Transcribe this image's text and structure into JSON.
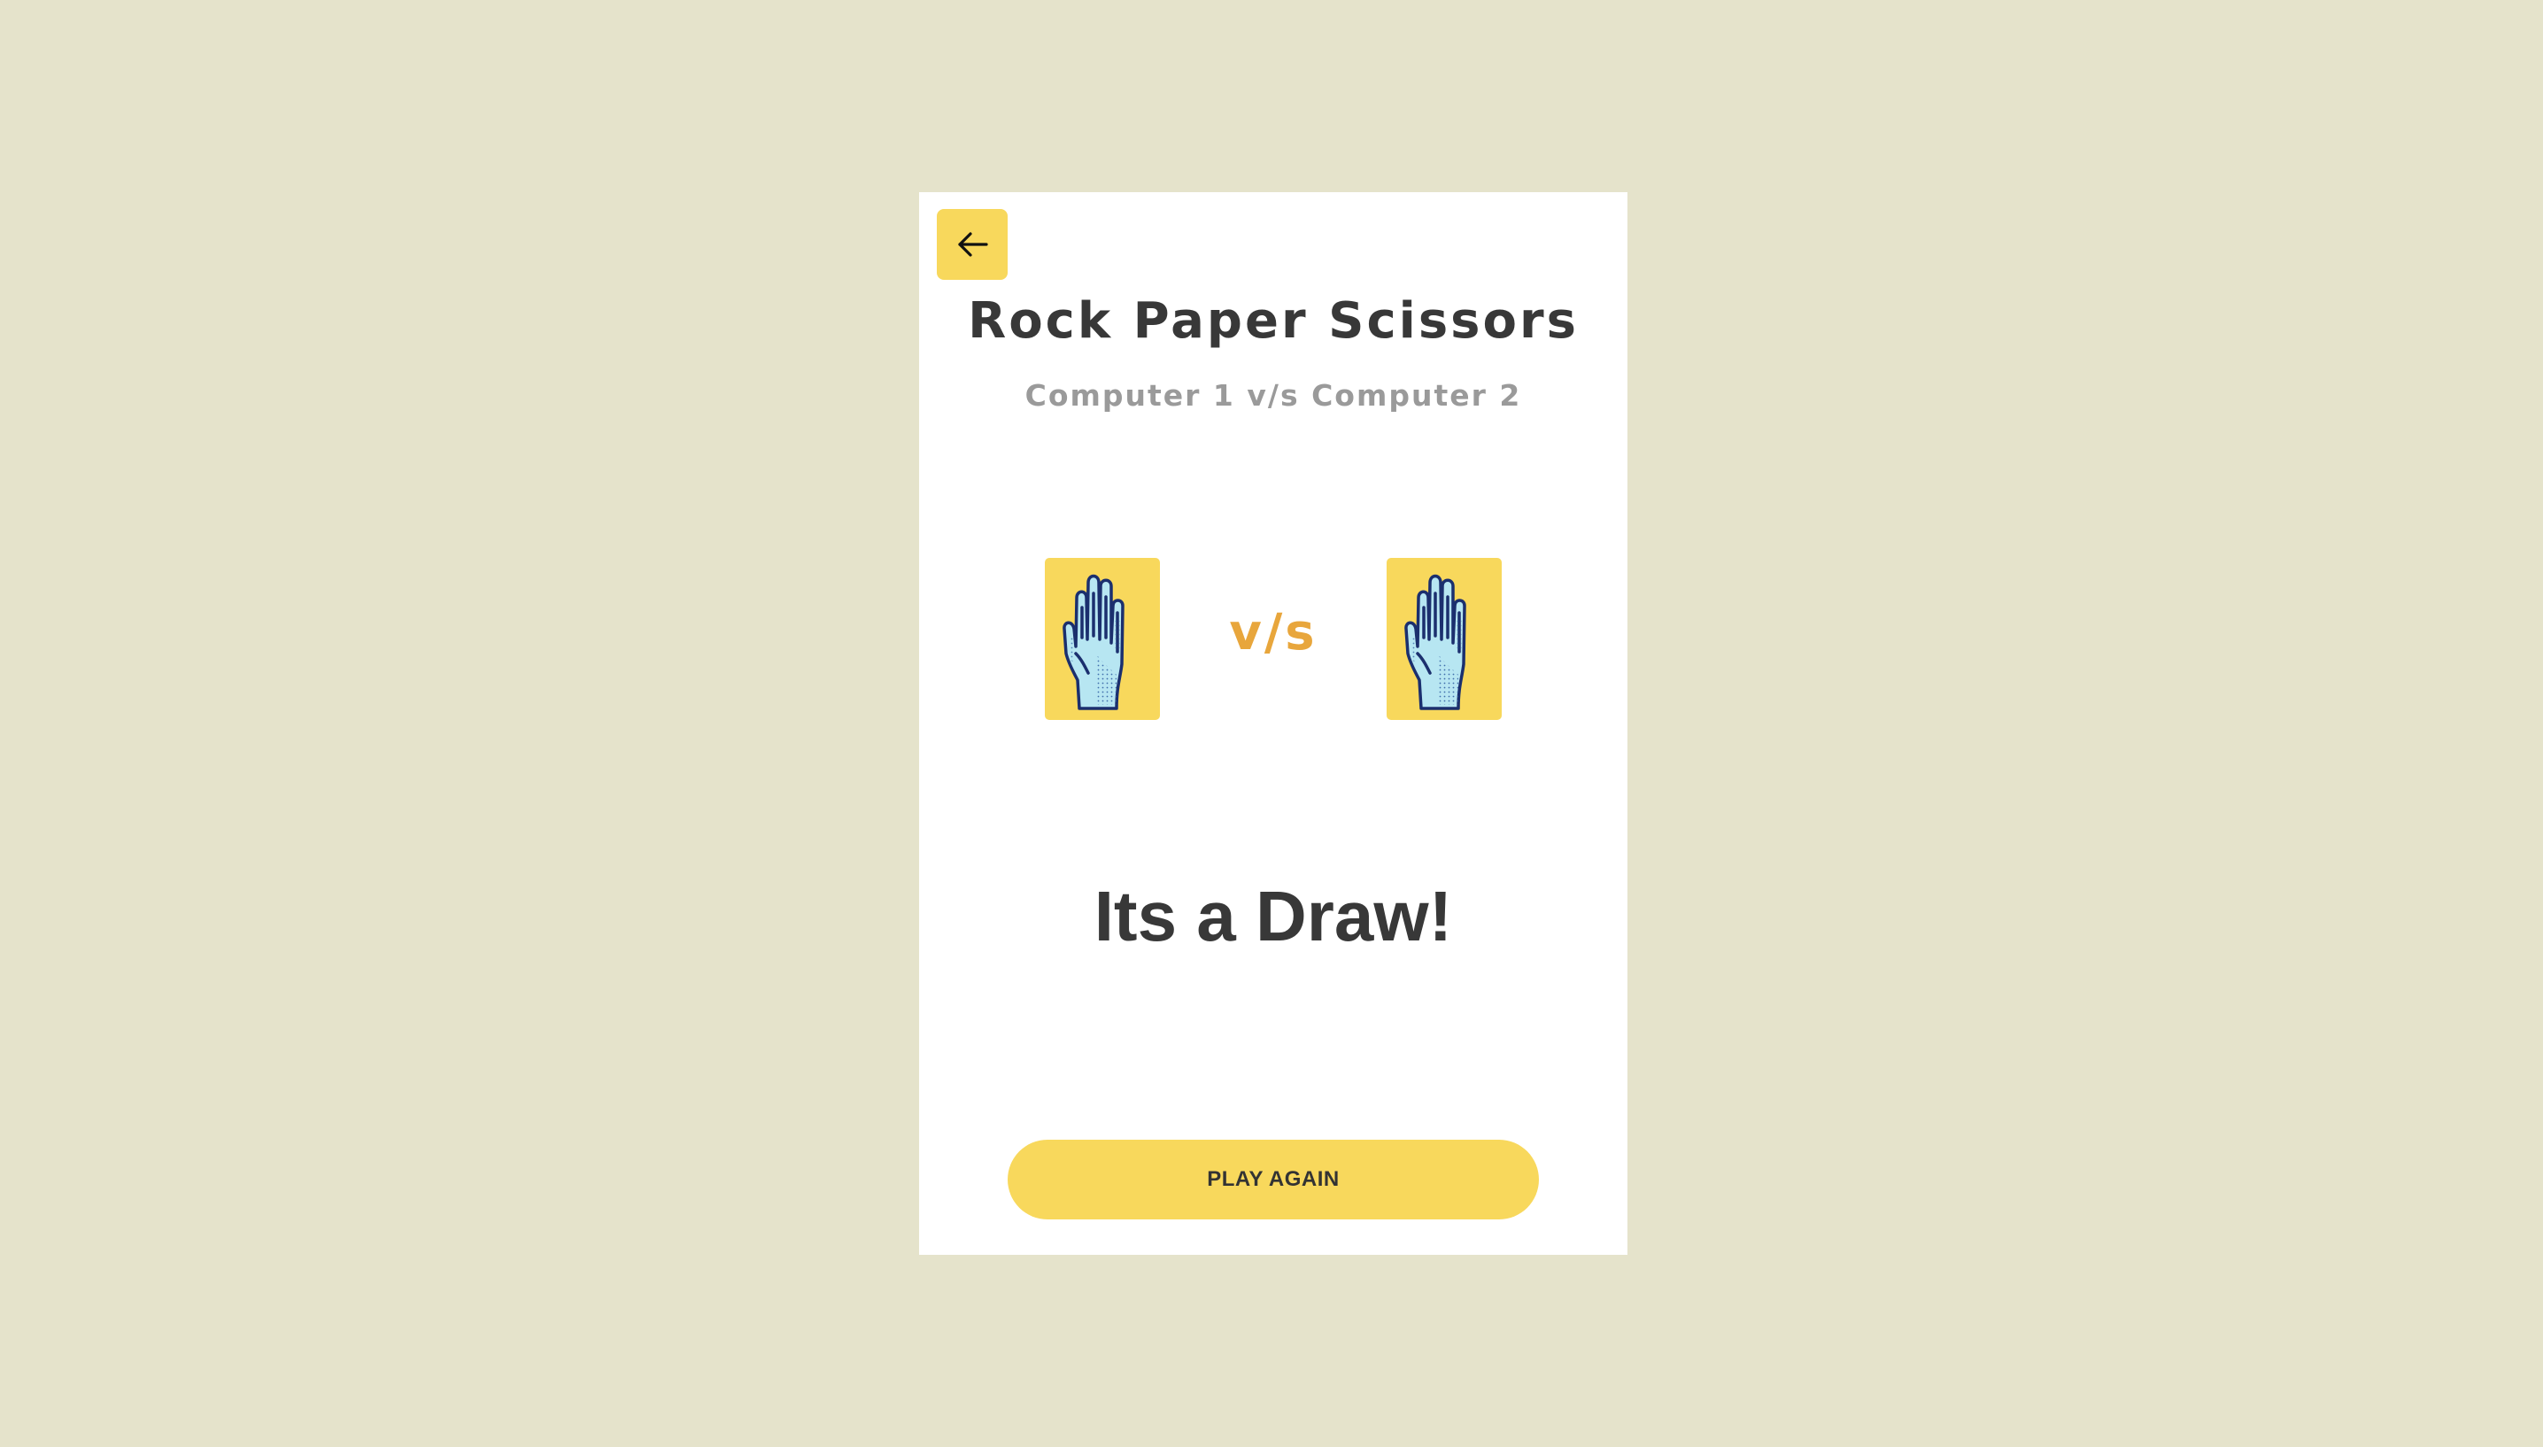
{
  "page": {
    "background": "#e5e3cb",
    "card_background": "#ffffff",
    "accent": "#f8d85c",
    "vs_color": "#e8a63c"
  },
  "header": {
    "back_icon": "arrow-left-icon",
    "title": "Rock Paper Scissors",
    "subtitle": "Computer 1 v/s Computer 2"
  },
  "match": {
    "player1_choice_icon": "paper-hand-icon",
    "separator": "v/s",
    "player2_choice_icon": "paper-hand-icon"
  },
  "result": {
    "text": "Its a Draw!"
  },
  "actions": {
    "play_again_label": "PLAY AGAIN"
  }
}
